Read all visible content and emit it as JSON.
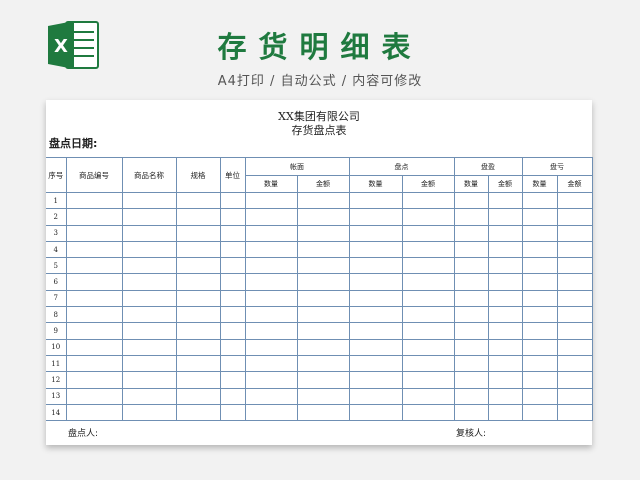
{
  "app": {
    "icon": "excel-icon"
  },
  "header": {
    "title": "存货明细表",
    "subtitle": "A4打印 / 自动公式 / 内容可修改"
  },
  "sheet": {
    "company": "XX集团有限公司",
    "form_name": "存货盘点表",
    "date_label": "盘点日期:",
    "columns": {
      "seq": "序号",
      "code": "商品编号",
      "name": "商品名称",
      "spec": "规格",
      "unit": "单位",
      "book": "帐面",
      "count": "盘点",
      "surplus": "盘盈",
      "loss": "盘亏",
      "qty": "数量",
      "amount": "金额"
    },
    "rows": [
      "1",
      "2",
      "3",
      "4",
      "5",
      "6",
      "7",
      "8",
      "9",
      "10",
      "11",
      "12",
      "13",
      "14"
    ],
    "footer": {
      "counter": "盘点人:",
      "reviewer": "复核人:"
    }
  },
  "colors": {
    "brand": "#1f7a3f",
    "grid": "#6f8fb3"
  }
}
